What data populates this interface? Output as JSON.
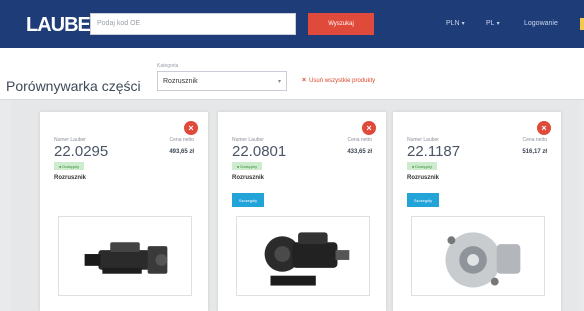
{
  "header": {
    "logo": "LAUBER",
    "search_placeholder": "Podaj kod OE",
    "search_button": "Wyszukaj",
    "currency": "PLN",
    "language": "PL",
    "account": "Logowanie"
  },
  "toolbar": {
    "page_title": "Porównywarka części",
    "category_label": "Kategoria",
    "category_value": "Rozrusznik",
    "remove_all": "Usuń wszystkie produkty"
  },
  "products": [
    {
      "number_label": "Numer Lauber",
      "number": "22.0295",
      "price_label": "Cena netto",
      "price": "493,65 zł",
      "availability": "Dostępny",
      "name": "Rozrusznik",
      "details_button": ""
    },
    {
      "number_label": "Numer Lauber",
      "number": "22.0801",
      "price_label": "Cena netto",
      "price": "433,65 zł",
      "availability": "Dostępny",
      "name": "Rozrusznik",
      "details_button": "Szczegóły"
    },
    {
      "number_label": "Numer Lauber",
      "number": "22.1187",
      "price_label": "Cena netto",
      "price": "516,17 zł",
      "availability": "Dostępny",
      "name": "Rozrusznik",
      "details_button": "Szczegóły"
    }
  ],
  "colors": {
    "header_bg": "#1d3c78",
    "accent_red": "#e04a3b",
    "details_blue": "#22a4d9",
    "badge_green": "#cdeccd"
  },
  "icons": {
    "close": "close-icon",
    "remove": "close-icon",
    "caret": "chevron-down-icon"
  }
}
